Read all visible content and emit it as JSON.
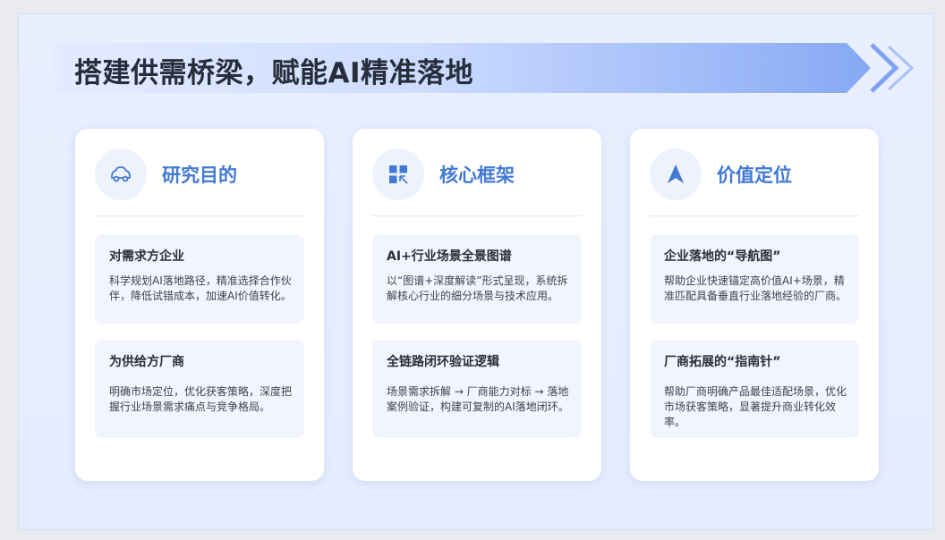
{
  "header": {
    "title": "搭建供需桥梁，赋能AI精准落地"
  },
  "colors": {
    "accent": "#4279d4",
    "banner_start": "#dfe8ff",
    "banner_end": "#8aabf5",
    "text_dark": "#262d3b"
  },
  "cards": [
    {
      "title": "研究目的",
      "icon": "car-icon",
      "items": [
        {
          "title": "对需求方企业",
          "desc": "科学规划AI落地路径，精准选择合作伙伴，降低试错成本，加速AI价值转化。"
        },
        {
          "title": "为供给方厂商",
          "desc": "明确市场定位，优化获客策略，深度把握行业场景需求痛点与竞争格局。"
        }
      ]
    },
    {
      "title": "核心框架",
      "icon": "grid-framework-icon",
      "items": [
        {
          "title": "AI+行业场景全景图谱",
          "desc": "以“图谱+深度解读”形式呈现，系统拆解核心行业的细分场景与技术应用。"
        },
        {
          "title": "全链路闭环验证逻辑",
          "desc": "场景需求拆解 → 厂商能力对标 → 落地案例验证，构建可复制的AI落地闭环。"
        }
      ]
    },
    {
      "title": "价值定位",
      "icon": "navigation-arrow-icon",
      "items": [
        {
          "title": "企业落地的“导航图”",
          "desc": "帮助企业快速锚定高价值AI+场景，精准匹配具备垂直行业落地经验的厂商。"
        },
        {
          "title": "厂商拓展的“指南针”",
          "desc": "帮助厂商明确产品最佳适配场景，优化市场获客策略，显著提升商业转化效率。"
        }
      ]
    }
  ]
}
